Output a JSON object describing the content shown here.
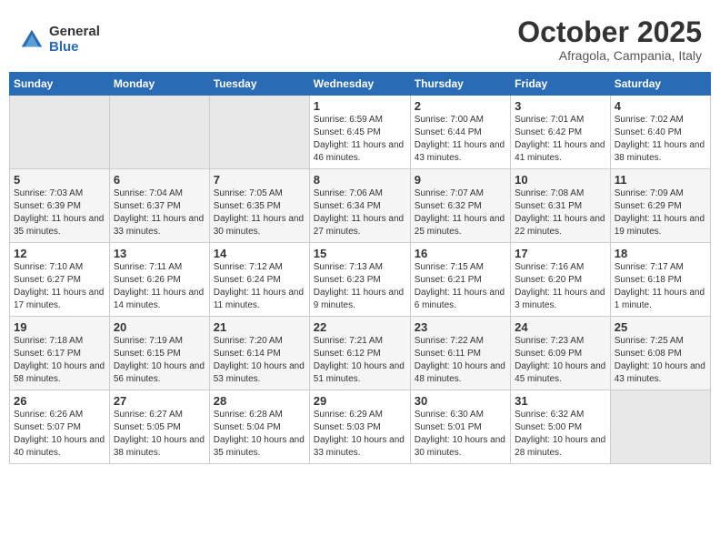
{
  "header": {
    "logo_general": "General",
    "logo_blue": "Blue",
    "month": "October 2025",
    "location": "Afragola, Campania, Italy"
  },
  "weekdays": [
    "Sunday",
    "Monday",
    "Tuesday",
    "Wednesday",
    "Thursday",
    "Friday",
    "Saturday"
  ],
  "weeks": [
    [
      {
        "day": "",
        "info": ""
      },
      {
        "day": "",
        "info": ""
      },
      {
        "day": "",
        "info": ""
      },
      {
        "day": "1",
        "info": "Sunrise: 6:59 AM\nSunset: 6:45 PM\nDaylight: 11 hours and 46 minutes."
      },
      {
        "day": "2",
        "info": "Sunrise: 7:00 AM\nSunset: 6:44 PM\nDaylight: 11 hours and 43 minutes."
      },
      {
        "day": "3",
        "info": "Sunrise: 7:01 AM\nSunset: 6:42 PM\nDaylight: 11 hours and 41 minutes."
      },
      {
        "day": "4",
        "info": "Sunrise: 7:02 AM\nSunset: 6:40 PM\nDaylight: 11 hours and 38 minutes."
      }
    ],
    [
      {
        "day": "5",
        "info": "Sunrise: 7:03 AM\nSunset: 6:39 PM\nDaylight: 11 hours and 35 minutes."
      },
      {
        "day": "6",
        "info": "Sunrise: 7:04 AM\nSunset: 6:37 PM\nDaylight: 11 hours and 33 minutes."
      },
      {
        "day": "7",
        "info": "Sunrise: 7:05 AM\nSunset: 6:35 PM\nDaylight: 11 hours and 30 minutes."
      },
      {
        "day": "8",
        "info": "Sunrise: 7:06 AM\nSunset: 6:34 PM\nDaylight: 11 hours and 27 minutes."
      },
      {
        "day": "9",
        "info": "Sunrise: 7:07 AM\nSunset: 6:32 PM\nDaylight: 11 hours and 25 minutes."
      },
      {
        "day": "10",
        "info": "Sunrise: 7:08 AM\nSunset: 6:31 PM\nDaylight: 11 hours and 22 minutes."
      },
      {
        "day": "11",
        "info": "Sunrise: 7:09 AM\nSunset: 6:29 PM\nDaylight: 11 hours and 19 minutes."
      }
    ],
    [
      {
        "day": "12",
        "info": "Sunrise: 7:10 AM\nSunset: 6:27 PM\nDaylight: 11 hours and 17 minutes."
      },
      {
        "day": "13",
        "info": "Sunrise: 7:11 AM\nSunset: 6:26 PM\nDaylight: 11 hours and 14 minutes."
      },
      {
        "day": "14",
        "info": "Sunrise: 7:12 AM\nSunset: 6:24 PM\nDaylight: 11 hours and 11 minutes."
      },
      {
        "day": "15",
        "info": "Sunrise: 7:13 AM\nSunset: 6:23 PM\nDaylight: 11 hours and 9 minutes."
      },
      {
        "day": "16",
        "info": "Sunrise: 7:15 AM\nSunset: 6:21 PM\nDaylight: 11 hours and 6 minutes."
      },
      {
        "day": "17",
        "info": "Sunrise: 7:16 AM\nSunset: 6:20 PM\nDaylight: 11 hours and 3 minutes."
      },
      {
        "day": "18",
        "info": "Sunrise: 7:17 AM\nSunset: 6:18 PM\nDaylight: 11 hours and 1 minute."
      }
    ],
    [
      {
        "day": "19",
        "info": "Sunrise: 7:18 AM\nSunset: 6:17 PM\nDaylight: 10 hours and 58 minutes."
      },
      {
        "day": "20",
        "info": "Sunrise: 7:19 AM\nSunset: 6:15 PM\nDaylight: 10 hours and 56 minutes."
      },
      {
        "day": "21",
        "info": "Sunrise: 7:20 AM\nSunset: 6:14 PM\nDaylight: 10 hours and 53 minutes."
      },
      {
        "day": "22",
        "info": "Sunrise: 7:21 AM\nSunset: 6:12 PM\nDaylight: 10 hours and 51 minutes."
      },
      {
        "day": "23",
        "info": "Sunrise: 7:22 AM\nSunset: 6:11 PM\nDaylight: 10 hours and 48 minutes."
      },
      {
        "day": "24",
        "info": "Sunrise: 7:23 AM\nSunset: 6:09 PM\nDaylight: 10 hours and 45 minutes."
      },
      {
        "day": "25",
        "info": "Sunrise: 7:25 AM\nSunset: 6:08 PM\nDaylight: 10 hours and 43 minutes."
      }
    ],
    [
      {
        "day": "26",
        "info": "Sunrise: 6:26 AM\nSunset: 5:07 PM\nDaylight: 10 hours and 40 minutes."
      },
      {
        "day": "27",
        "info": "Sunrise: 6:27 AM\nSunset: 5:05 PM\nDaylight: 10 hours and 38 minutes."
      },
      {
        "day": "28",
        "info": "Sunrise: 6:28 AM\nSunset: 5:04 PM\nDaylight: 10 hours and 35 minutes."
      },
      {
        "day": "29",
        "info": "Sunrise: 6:29 AM\nSunset: 5:03 PM\nDaylight: 10 hours and 33 minutes."
      },
      {
        "day": "30",
        "info": "Sunrise: 6:30 AM\nSunset: 5:01 PM\nDaylight: 10 hours and 30 minutes."
      },
      {
        "day": "31",
        "info": "Sunrise: 6:32 AM\nSunset: 5:00 PM\nDaylight: 10 hours and 28 minutes."
      },
      {
        "day": "",
        "info": ""
      }
    ]
  ]
}
